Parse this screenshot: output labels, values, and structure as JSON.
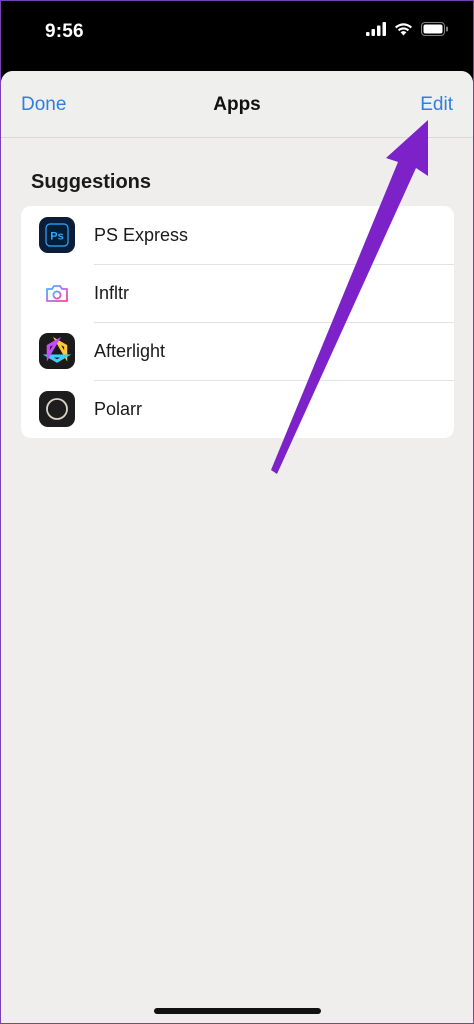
{
  "status_bar": {
    "time": "9:56",
    "icons": [
      "cellular-signal-icon",
      "wifi-icon",
      "battery-icon"
    ]
  },
  "nav": {
    "done_label": "Done",
    "title": "Apps",
    "edit_label": "Edit"
  },
  "suggestions": {
    "title": "Suggestions",
    "items": [
      {
        "label": "PS Express",
        "icon": "ps-express-icon"
      },
      {
        "label": "Infltr",
        "icon": "infltr-icon"
      },
      {
        "label": "Afterlight",
        "icon": "afterlight-icon"
      },
      {
        "label": "Polarr",
        "icon": "polarr-icon"
      }
    ]
  },
  "colors": {
    "accent": "#2f7fe0",
    "annotation_arrow": "#7d22c9",
    "sheet_background": "#efeeed"
  }
}
